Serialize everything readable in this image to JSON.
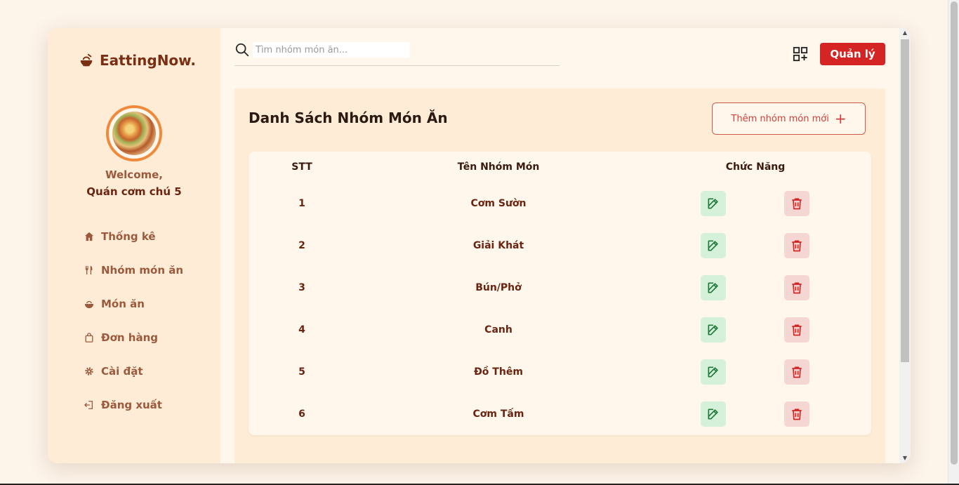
{
  "brand": {
    "name": "EattingNow."
  },
  "user": {
    "welcome": "Welcome,",
    "shop_name": "Quán cơm chú 5"
  },
  "sidebar": {
    "items": [
      {
        "label": "Thống kê",
        "icon": "home-icon"
      },
      {
        "label": "Nhóm món ăn",
        "icon": "utensils-icon"
      },
      {
        "label": "Món ăn",
        "icon": "food-bowl-icon"
      },
      {
        "label": "Đơn hàng",
        "icon": "shopping-bag-icon"
      },
      {
        "label": "Cài đặt",
        "icon": "gear-icon"
      },
      {
        "label": "Đăng xuất",
        "icon": "logout-icon"
      }
    ]
  },
  "header": {
    "search_placeholder": "Tìm nhóm món ăn...",
    "search_value": "",
    "manage_label": "Quản lý"
  },
  "content": {
    "title": "Danh Sách Nhóm Món Ăn",
    "add_label": "Thêm nhóm món mới",
    "add_icon": "+"
  },
  "table": {
    "headers": {
      "stt": "STT",
      "name": "Tên Nhóm Món",
      "func": "Chức Năng"
    },
    "rows": [
      {
        "stt": "1",
        "name": "Cơm Sườn"
      },
      {
        "stt": "2",
        "name": "Giải Khát"
      },
      {
        "stt": "3",
        "name": "Bún/Phở"
      },
      {
        "stt": "4",
        "name": "Canh"
      },
      {
        "stt": "5",
        "name": "Đồ Thêm"
      },
      {
        "stt": "6",
        "name": "Cơm Tấm"
      }
    ]
  },
  "colors": {
    "brand": "#7a2e12",
    "accent_orange": "#f08a3a",
    "manage_red": "#d42424",
    "edit_green": "#1e7a3a",
    "delete_red": "#d42424"
  }
}
